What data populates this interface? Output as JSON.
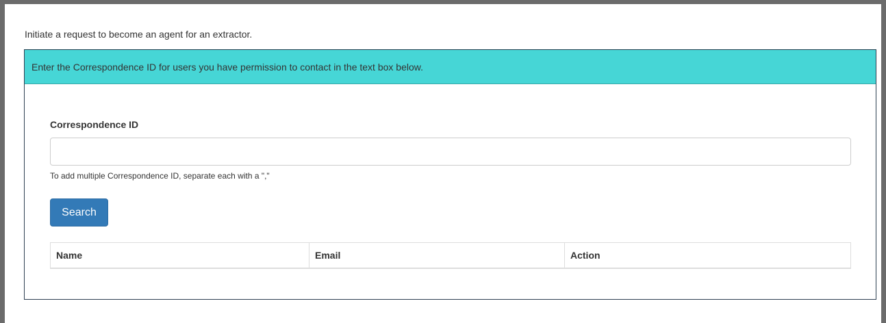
{
  "intro": {
    "text": "Initiate a request to become an agent for an extractor."
  },
  "panel": {
    "heading": "Enter the Correspondence ID for users you have permission to contact in the text box below."
  },
  "form": {
    "label": "Correspondence ID",
    "input_value": "",
    "input_placeholder": "",
    "help_text": "To add multiple Correspondence ID, separate each with a \",\"",
    "search_label": "Search"
  },
  "table": {
    "columns": [
      "Name",
      "Email",
      "Action"
    ]
  },
  "colors": {
    "panel_heading_bg": "#46d6d6",
    "button_primary": "#337ab7",
    "frame": "#6b6b6b"
  }
}
